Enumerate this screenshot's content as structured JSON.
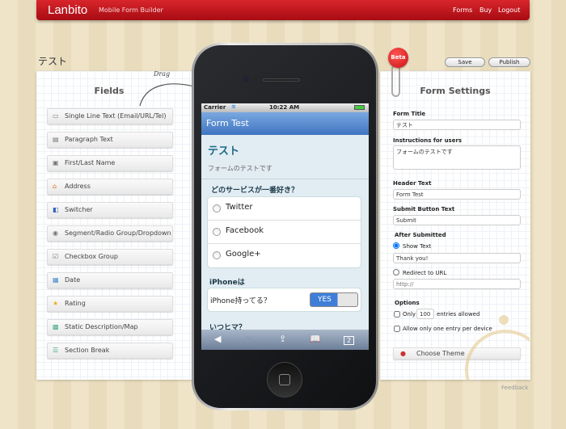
{
  "header": {
    "logo": "Lanbito",
    "tagline": "Mobile Form Builder",
    "nav": [
      "Forms",
      "Buy",
      "Logout"
    ]
  },
  "page": {
    "title": "テスト",
    "save_label": "Save",
    "publish_label": "Publish",
    "beta": "Beta",
    "feedback": "Feedback",
    "drag_hint": "Drag"
  },
  "fields": {
    "title": "Fields",
    "items": [
      {
        "label": "Single Line Text (Email/URL/Tel)",
        "icon": "textfield-icon"
      },
      {
        "label": "Paragraph Text",
        "icon": "paragraph-icon"
      },
      {
        "label": "First/Last Name",
        "icon": "name-card-icon"
      },
      {
        "label": "Address",
        "icon": "house-icon"
      },
      {
        "label": "Switcher",
        "icon": "switch-icon"
      },
      {
        "label": "Segment/Radio Group/Dropdown",
        "icon": "radio-icon"
      },
      {
        "label": "Checkbox Group",
        "icon": "checkbox-icon"
      },
      {
        "label": "Date",
        "icon": "calendar-icon"
      },
      {
        "label": "Rating",
        "icon": "star-icon"
      },
      {
        "label": "Static Description/Map",
        "icon": "map-icon"
      },
      {
        "label": "Section Break",
        "icon": "section-icon"
      }
    ]
  },
  "phone": {
    "carrier": "Carrier",
    "time": "10:22 AM",
    "nav_title": "Form Test",
    "form_title": "テスト",
    "instructions": "フォームのテストです",
    "question1": "どのサービスが一番好き？",
    "options": [
      "Twitter",
      "Facebook",
      "Google+"
    ],
    "section2": "iPhoneは",
    "switch_label": "iPhone持ってる？",
    "switch_value": "YES",
    "section3": "いつヒマ？",
    "tabs_count": "2"
  },
  "settings": {
    "title": "Form Settings",
    "form_title_label": "Form Title",
    "form_title": "テスト",
    "instructions_label": "Instructions for users",
    "instructions": "フォームのテストです",
    "header_label": "Header Text",
    "header": "Form Test",
    "submit_label": "Submit Button Text",
    "submit": "Submit",
    "after_label": "After Submitted",
    "show_text_label": "Show Text",
    "show_text_selected": true,
    "show_text": "Thank you!",
    "redirect_label": "Redirect to URL",
    "redirect_placeholder": "http://",
    "options_label": "Options",
    "only_label": "Only",
    "entries_value": "100",
    "entries_label": "entries allowed",
    "one_entry_label": "Allow only one entry per device",
    "theme_label": "Choose Theme"
  }
}
